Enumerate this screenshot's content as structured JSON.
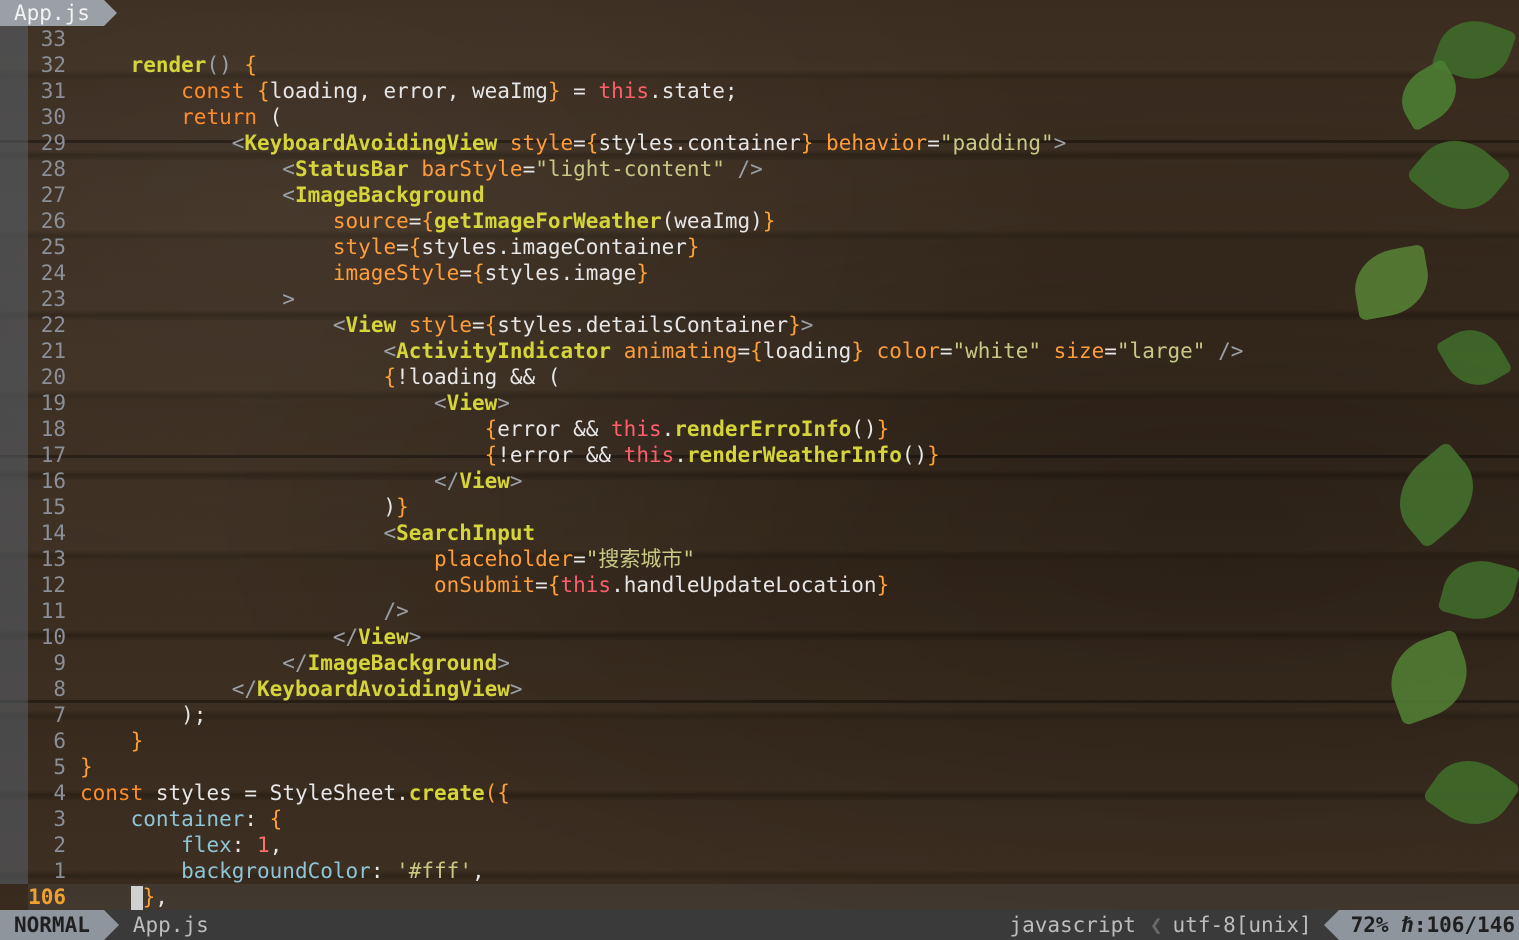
{
  "tab": {
    "label": "App.js"
  },
  "editor": {
    "lines": [
      {
        "n": "33"
      },
      {
        "n": "32"
      },
      {
        "n": "31"
      },
      {
        "n": "30"
      },
      {
        "n": "29"
      },
      {
        "n": "28"
      },
      {
        "n": "27"
      },
      {
        "n": "26"
      },
      {
        "n": "25"
      },
      {
        "n": "24"
      },
      {
        "n": "23"
      },
      {
        "n": "22"
      },
      {
        "n": "21"
      },
      {
        "n": "20"
      },
      {
        "n": "19"
      },
      {
        "n": "18"
      },
      {
        "n": "17"
      },
      {
        "n": "16"
      },
      {
        "n": "15"
      },
      {
        "n": "14"
      },
      {
        "n": "13"
      },
      {
        "n": "12"
      },
      {
        "n": "11"
      },
      {
        "n": "10"
      },
      {
        "n": "9"
      },
      {
        "n": "8"
      },
      {
        "n": "7"
      },
      {
        "n": "6"
      },
      {
        "n": "5"
      },
      {
        "n": "4"
      },
      {
        "n": "3"
      },
      {
        "n": "2"
      },
      {
        "n": "1"
      },
      {
        "n": "106"
      }
    ],
    "t": {
      "render": "render",
      "const": "const",
      "loading": "loading",
      "error": "error",
      "weaImg": "weaImg",
      "this": "this",
      "state": ".state;",
      "return": "return",
      "kav": "KeyboardAvoidingView",
      "style": "style",
      "stylesContainer": "styles.container",
      "behavior": "behavior",
      "padding": "\"padding\"",
      "statusBar": "StatusBar",
      "barStyle": "barStyle",
      "lightContent": "\"light-content\"",
      "imageBackground": "ImageBackground",
      "source": "source",
      "getImage": "getImageForWeather",
      "stylesImageContainer": "styles.imageContainer",
      "imageStyle": "imageStyle",
      "stylesImage": "styles.image",
      "view": "View",
      "stylesDetails": "styles.detailsContainer",
      "activity": "ActivityIndicator",
      "animating": "animating",
      "color": "color",
      "white": "\"white\"",
      "size": "size",
      "large": "\"large\"",
      "notLoading": "!loading && (",
      "errorAnd": "error && ",
      "renderErro": "renderErroInfo",
      "notErrorAnd": "!error && ",
      "renderWeather": "renderWeatherInfo",
      "searchInput": "SearchInput",
      "placeholder": "placeholder",
      "placeholderVal": "\"搜索城市\"",
      "onSubmit": "onSubmit",
      "handleUpdate": ".handleUpdateLocation",
      "styles": "styles",
      "styleSheet": "StyleSheet",
      "create": "create",
      "containerProp": "container",
      "flex": "flex",
      "one": "1",
      "backgroundColor": "backgroundColor",
      "fff": "'#fff'"
    }
  },
  "statusline": {
    "mode": "NORMAL",
    "file": "App.js",
    "filetype": "javascript",
    "encoding": "utf-8[unix]",
    "percent": "72%",
    "position": "ℏ:106/146"
  },
  "colors": {
    "keyword": "#ff8c2a",
    "function": "#d5d53a",
    "string": "#c9c986",
    "this": "#ff5f6d"
  }
}
